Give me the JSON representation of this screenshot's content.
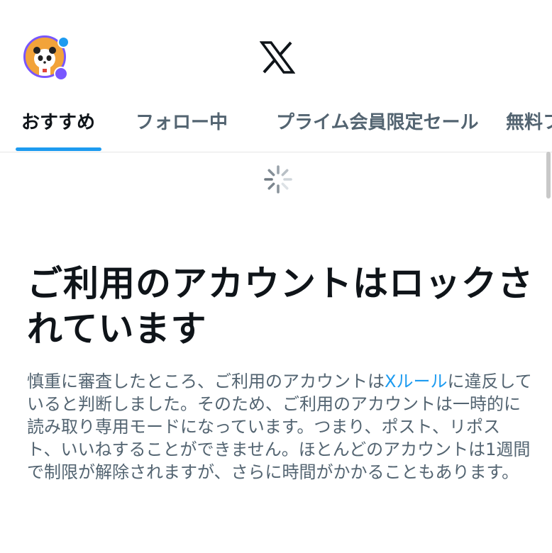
{
  "header": {
    "avatar_alt": "profile avatar",
    "logo": "X"
  },
  "tabs": [
    {
      "label": "おすすめ",
      "active": true
    },
    {
      "label": "フォロー中",
      "active": false
    },
    {
      "label": "プライム会員限定セール",
      "active": false
    },
    {
      "label": "無料フ",
      "active": false
    }
  ],
  "locked": {
    "title": "ご利用のアカウントはロックされています",
    "body_before_link": "慎重に審査したところ、ご利用のアカウントは",
    "rules_link": "Xルール",
    "body_after_link": "に違反していると判断しました。そのため、ご利用のアカウントは一時的に読み取り専用モードになっています。つまり、ポスト、リポスト、いいねすることができません。ほとんどのアカウントは1週間で制限が解除されますが、さらに時間がかかることもあります。"
  },
  "colors": {
    "accent": "#1d9bf0",
    "text_primary": "#0f1419",
    "text_secondary": "#536471",
    "avatar_ring": "#7856ff"
  }
}
